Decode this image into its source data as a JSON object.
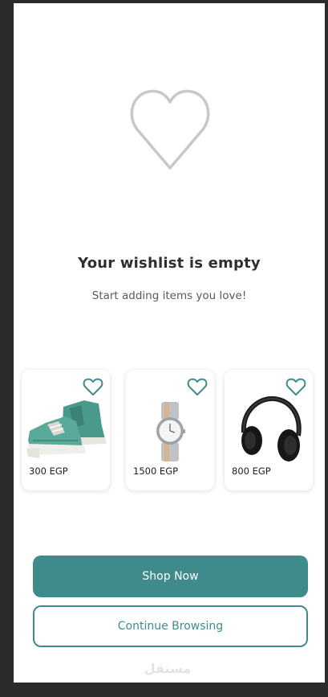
{
  "empty_state": {
    "title": "Your wishlist is empty",
    "subtitle": "Start adding items you love!",
    "icon": "heart-outline-icon"
  },
  "products": [
    {
      "name": "sneakers",
      "price": "300 EGP",
      "icon": "heart-outline-icon"
    },
    {
      "name": "watch",
      "price": "1500 EGP",
      "icon": "heart-outline-icon"
    },
    {
      "name": "headphones",
      "price": "800 EGP",
      "icon": "heart-outline-icon"
    }
  ],
  "actions": {
    "shop_now": "Shop Now",
    "continue_browsing": "Continue Browsing"
  },
  "watermark": "مستقل",
  "colors": {
    "accent": "#3f8b8c",
    "heart_outline": "#c8c8c8",
    "background": "#ffffff",
    "frame": "#2b2b2b"
  }
}
